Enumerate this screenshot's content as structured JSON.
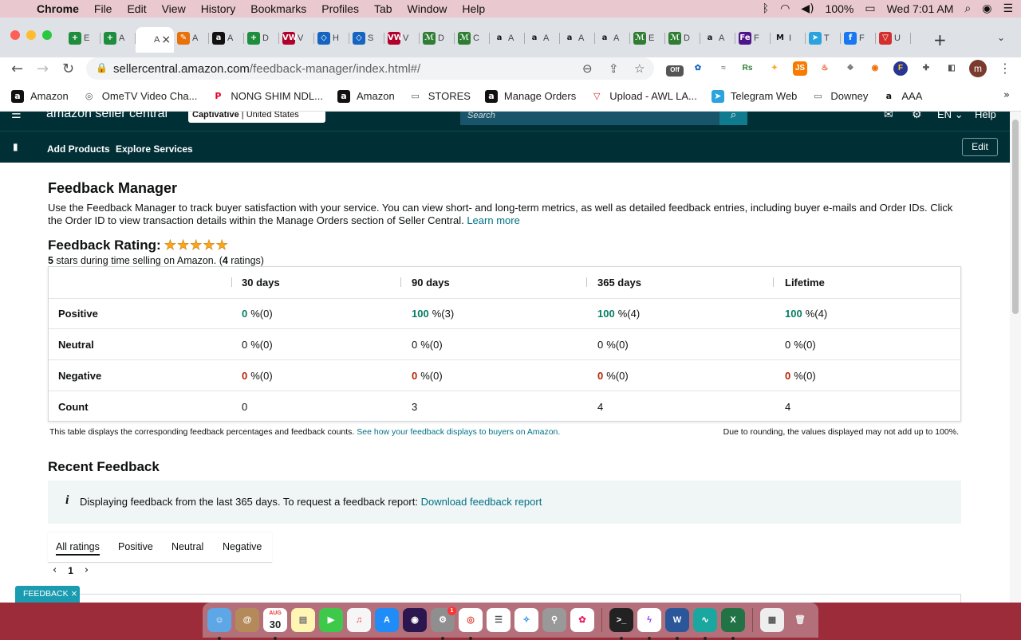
{
  "menubar": {
    "app": "Chrome",
    "items": [
      "File",
      "Edit",
      "View",
      "History",
      "Bookmarks",
      "Profiles",
      "Tab",
      "Window",
      "Help"
    ],
    "battery": "100%",
    "clock": "Wed 7:01 AM"
  },
  "tabs": [
    {
      "fav": "+",
      "label": "E",
      "color": "#1e8e3e"
    },
    {
      "fav": "+",
      "label": "A",
      "color": "#1e8e3e"
    },
    {
      "fav": "",
      "label": "A",
      "color": "",
      "active": true
    },
    {
      "fav": "✎",
      "label": "A",
      "color": "#e8710a"
    },
    {
      "fav": "a",
      "label": "A",
      "color": "#111111"
    },
    {
      "fav": "+",
      "label": "D",
      "color": "#1e8e3e"
    },
    {
      "fav": "VW",
      "label": "V",
      "color": "#b0002b"
    },
    {
      "fav": "◇",
      "label": "H",
      "color": "#1565c0"
    },
    {
      "fav": "◇",
      "label": "S",
      "color": "#1565c0"
    },
    {
      "fav": "VW",
      "label": "V",
      "color": "#b0002b"
    },
    {
      "fav": "ℳ",
      "label": "D",
      "color": "#2e7d32"
    },
    {
      "fav": "ℳ",
      "label": "C",
      "color": "#2e7d32"
    },
    {
      "fav": "a",
      "label": "A",
      "color": "#ffffff"
    },
    {
      "fav": "a",
      "label": "A",
      "color": "#ffffff"
    },
    {
      "fav": "a",
      "label": "A",
      "color": "#ffffff"
    },
    {
      "fav": "a",
      "label": "A",
      "color": "#ffffff"
    },
    {
      "fav": "ℳ",
      "label": "E",
      "color": "#2e7d32"
    },
    {
      "fav": "ℳ",
      "label": "D",
      "color": "#2e7d32"
    },
    {
      "fav": "a",
      "label": "A",
      "color": "#ffffff"
    },
    {
      "fav": "Fe",
      "label": "F",
      "color": "#4d148c"
    },
    {
      "fav": "M",
      "label": "I",
      "color": "#ffffff"
    },
    {
      "fav": "➤",
      "label": "T",
      "color": "#2aa3df"
    },
    {
      "fav": "f",
      "label": "F",
      "color": "#1877f2"
    },
    {
      "fav": "▽",
      "label": "U",
      "color": "#d32f2f"
    }
  ],
  "address": {
    "host": "sellercentral.amazon.com",
    "path": "/feedback-manager/index.html#/",
    "ext_badge": "Off"
  },
  "profile_initial": "m",
  "bookmarks": [
    {
      "label": "Amazon",
      "icon": "a",
      "bg": "#111111",
      "fg": "#ffffff"
    },
    {
      "label": "OmeTV Video Cha...",
      "icon": "◎",
      "bg": "#ffffff",
      "fg": "#555555"
    },
    {
      "label": "NONG SHIM NDL...",
      "icon": "P",
      "bg": "#ffffff",
      "fg": "#e60023"
    },
    {
      "label": "Amazon",
      "icon": "a",
      "bg": "#111111",
      "fg": "#ffffff"
    },
    {
      "label": "STORES",
      "icon": "▭",
      "bg": "#ffffff",
      "fg": "#555555"
    },
    {
      "label": "Manage Orders",
      "icon": "a",
      "bg": "#111111",
      "fg": "#ffffff"
    },
    {
      "label": "Upload - AWL LA...",
      "icon": "▽",
      "bg": "#ffffff",
      "fg": "#c62828"
    },
    {
      "label": "Telegram Web",
      "icon": "➤",
      "bg": "#2aa3df",
      "fg": "#ffffff"
    },
    {
      "label": "Downey",
      "icon": "▭",
      "bg": "#ffffff",
      "fg": "#555555"
    },
    {
      "label": "AAA",
      "icon": "a",
      "bg": "#ffffff",
      "fg": "#111111"
    }
  ],
  "seller": {
    "logo": "amazon seller central",
    "store": "Captivative",
    "marketplace": "United States",
    "search_placeholder": "Search",
    "lang": "EN",
    "help": "Help",
    "nav": [
      "Add Products",
      "Explore Services"
    ],
    "edit": "Edit"
  },
  "page": {
    "title": "Feedback Manager",
    "description": "Use the Feedback Manager to track buyer satisfaction with your service. You can view short- and long-term metrics, as well as detailed feedback entries, including buyer e-mails and Order IDs. Click the Order ID to view transaction details within the Manage Orders section of Seller Central.",
    "learn_more": "Learn more",
    "rating_label": "Feedback Rating:",
    "rating_stars": 5,
    "rating_sub_stars": "5",
    "rating_sub_text": " stars during time selling on Amazon. (",
    "rating_count": "4",
    "rating_count_suffix": " ratings)"
  },
  "feedback_table": {
    "columns": [
      "30 days",
      "90 days",
      "365 days",
      "Lifetime"
    ],
    "rows": [
      {
        "label": "Positive",
        "cells": [
          {
            "v": "0",
            "rest": "%(0)",
            "tone": "g"
          },
          {
            "v": "100",
            "rest": "%(3)",
            "tone": "g"
          },
          {
            "v": "100",
            "rest": "%(4)",
            "tone": "g"
          },
          {
            "v": "100",
            "rest": "%(4)",
            "tone": "g"
          }
        ]
      },
      {
        "label": "Neutral",
        "cells": [
          {
            "v": "0",
            "rest": "%(0)",
            "tone": "n"
          },
          {
            "v": "0",
            "rest": "%(0)",
            "tone": "n"
          },
          {
            "v": "0",
            "rest": "%(0)",
            "tone": "n"
          },
          {
            "v": "0",
            "rest": "%(0)",
            "tone": "n"
          }
        ]
      },
      {
        "label": "Negative",
        "cells": [
          {
            "v": "0",
            "rest": "%(0)",
            "tone": "r"
          },
          {
            "v": "0",
            "rest": "%(0)",
            "tone": "r"
          },
          {
            "v": "0",
            "rest": "%(0)",
            "tone": "r"
          },
          {
            "v": "0",
            "rest": "%(0)",
            "tone": "r"
          }
        ]
      },
      {
        "label": "Count",
        "cells": [
          {
            "v": "0",
            "rest": "",
            "tone": "plain"
          },
          {
            "v": "3",
            "rest": "",
            "tone": "plain"
          },
          {
            "v": "4",
            "rest": "",
            "tone": "plain"
          },
          {
            "v": "4",
            "rest": "",
            "tone": "plain"
          }
        ]
      }
    ],
    "note": "This table displays the corresponding feedback percentages and feedback counts.",
    "note_link": "See how your feedback displays to buyers on Amazon.",
    "rounding_note": "Due to rounding, the values displayed may not add up to 100%."
  },
  "recent": {
    "title": "Recent Feedback",
    "info": "Displaying feedback from the last 365 days. To request a feedback report:",
    "info_link": "Download feedback report",
    "filters": [
      "All ratings",
      "Positive",
      "Neutral",
      "Negative"
    ],
    "page": "1"
  },
  "widget": {
    "label": "FEEDBACK",
    "close": "×"
  },
  "dock": {
    "calendar_month": "AUG",
    "calendar_day": "30",
    "notification_badge": "1"
  },
  "colors": {
    "positive": "#067d62",
    "negative": "#b12704",
    "link": "#007185",
    "seller_header": "#002f36",
    "star": "#ffa41c"
  }
}
